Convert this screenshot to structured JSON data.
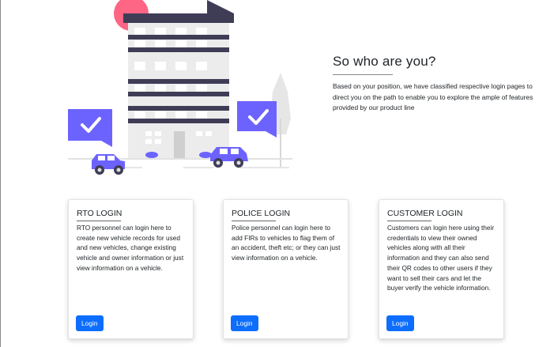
{
  "intro": {
    "title": "So who are you?",
    "description": "Based on your position, we have classified respective login pages to direct you on the path to enable you to explore the ample of features provided by our product line"
  },
  "cards": [
    {
      "title": "RTO LOGIN",
      "description": "RTO personnel can login here to create new vehicle records for used and new vehicles, change existing vehicle and owner information or just view information on a vehicle.",
      "button_label": "Login"
    },
    {
      "title": "POLICE LOGIN",
      "description": "Police personnel can login here to add FIRs to vehicles to flag them of an accident, theft etc; or they can just view information on a vehicle.",
      "button_label": "Login"
    },
    {
      "title": "CUSTOMER LOGIN",
      "description": "Customers can login here using their credentials to view their owned vehicles along with all their information and they can also send their QR codes to other users if they want to sell their cars and let the buyer verify the vehicle information.",
      "button_label": "Login"
    }
  ],
  "colors": {
    "accent": "#6c63ff",
    "button": "#0d6efd",
    "building_dark": "#3f3d56",
    "sun": "#ff6584"
  }
}
